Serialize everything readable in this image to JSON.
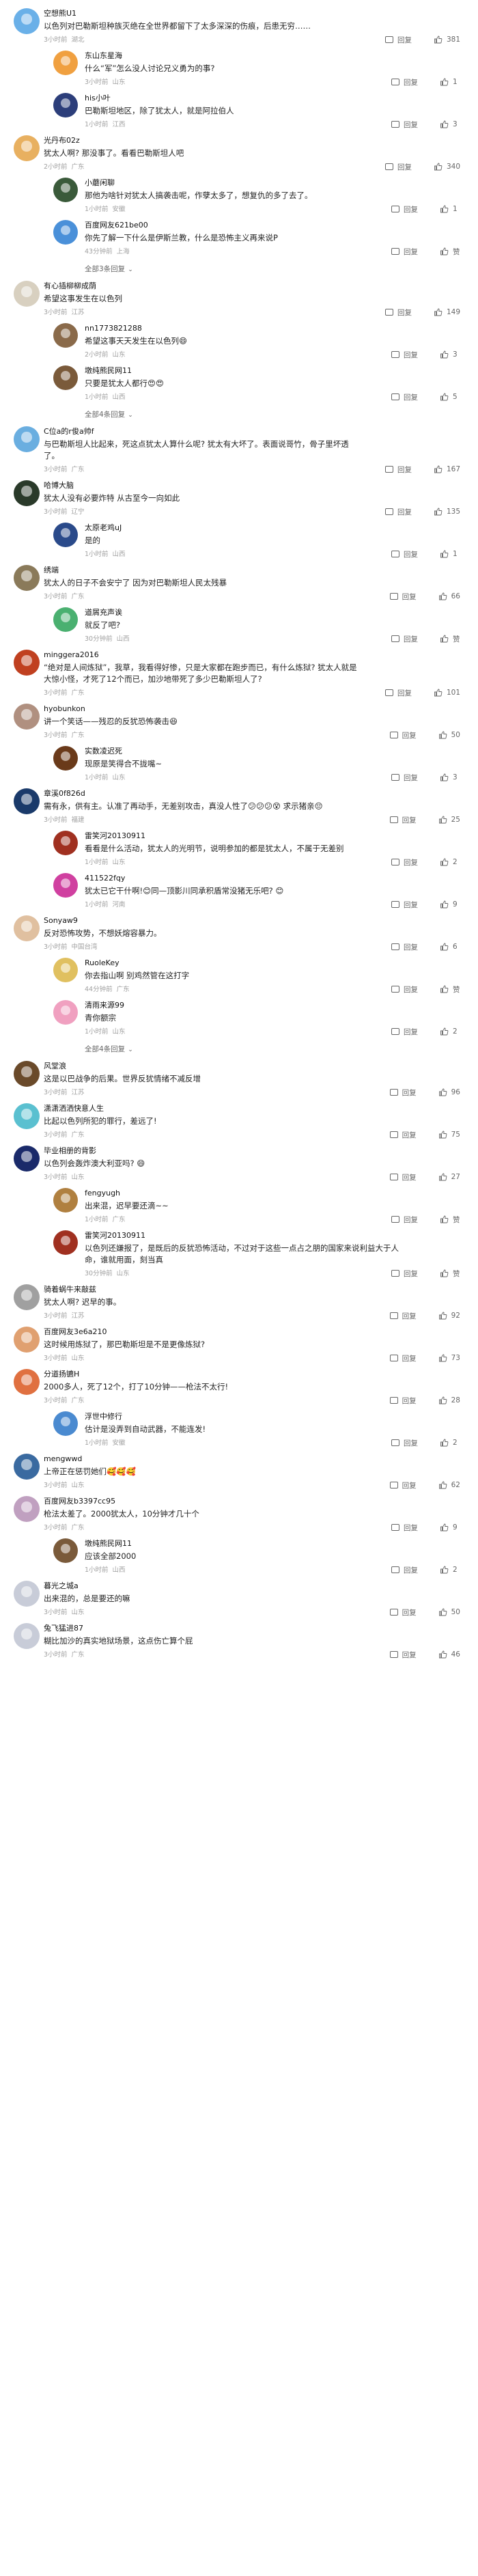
{
  "ui": {
    "reply_label": "回复",
    "zan_label": "赞",
    "more_suffix_icon": "chevron-down-icon"
  },
  "comments": [
    {
      "kind": "top",
      "user": "空想熊U1",
      "text": "以色列对巴勒斯坦种族灭绝在全世界都留下了太多深深的伤痕，后患无穷……",
      "time": "3小时前",
      "loc": "湖北",
      "likes": "381",
      "color": "#6ab0e8"
    },
    {
      "kind": "reply",
      "user": "东山东星海",
      "text": "什么“军”怎么没人讨论兄义勇为的事?",
      "time": "3小时前",
      "loc": "山东",
      "likes": "1",
      "color": "#f0a040"
    },
    {
      "kind": "reply",
      "user": "his小叶",
      "text": "巴勒斯坦地区，除了犹太人，就是阿拉伯人",
      "time": "1小时前",
      "loc": "江西",
      "likes": "3",
      "color": "#2c3e7a"
    },
    {
      "kind": "top",
      "user": "光丹布02z",
      "text": "犹太人啊? 那没事了。看看巴勒斯坦人吧",
      "time": "2小时前",
      "loc": "广东",
      "likes": "340",
      "color": "#e8b060"
    },
    {
      "kind": "reply",
      "user": "小蘑闲聊",
      "text": "那他为啥针对犹太人搞袭击呢，作孽太多了，想复仇的多了去了。",
      "time": "1小时前",
      "loc": "安徽",
      "likes": "1",
      "color": "#3a5a3a"
    },
    {
      "kind": "reply",
      "user": "百度网友621be00",
      "text": "你先了解一下什么是伊斯兰教，什么是恐怖主义再来说P",
      "time": "43分钟前",
      "loc": "上海",
      "likes": "",
      "color": "#4a90d9"
    },
    {
      "kind": "more",
      "text": "全部3条回复"
    },
    {
      "kind": "top",
      "user": "有心插柳柳成荫",
      "text": "希望这事发生在以色列",
      "time": "3小时前",
      "loc": "江苏",
      "likes": "149",
      "color": "#d8d0c0"
    },
    {
      "kind": "reply",
      "user": "nn1773821288",
      "text": "希望这事天天发生在以色列😄",
      "time": "2小时前",
      "loc": "山东",
      "likes": "3",
      "color": "#8a6a4a"
    },
    {
      "kind": "reply",
      "user": "墩纯熊民网11",
      "text": "只要是犹太人都行😍😍",
      "time": "1小时前",
      "loc": "山西",
      "likes": "5",
      "color": "#7a5a3a"
    },
    {
      "kind": "more",
      "text": "全部4条回复"
    },
    {
      "kind": "top",
      "user": "C位a的r俊a帅f",
      "text": "与巴勒斯坦人比起来，死这点犹太人算什么呢? 犹太有大坏了。表面说哥竹，骨子里坏透了。",
      "time": "3小时前",
      "loc": "广东",
      "likes": "167",
      "color": "#6aaee0"
    },
    {
      "kind": "top",
      "user": "哈博大脑",
      "text": "犹太人没有必要炸特 从古至今一向如此",
      "time": "3小时前",
      "loc": "辽宁",
      "likes": "135",
      "color": "#2a3a2a"
    },
    {
      "kind": "reply",
      "user": "太原老鸡uJ",
      "text": "是的",
      "time": "1小时前",
      "loc": "山西",
      "likes": "1",
      "color": "#2a4a8a"
    },
    {
      "kind": "top",
      "user": "绣端",
      "text": "犹太人的日子不会安宁了 因为对巴勒斯坦人民太残暴",
      "time": "3小时前",
      "loc": "广东",
      "likes": "66",
      "color": "#8a7a5a"
    },
    {
      "kind": "reply",
      "user": "道屑充声诶",
      "text": "就反了吧?",
      "time": "30分钟前",
      "loc": "山西",
      "likes": "",
      "color": "#4ab070"
    },
    {
      "kind": "top",
      "user": "minggera2016",
      "text": "“绝对是人间炼狱”，我草，我看得好惨，只是大家都在跑步而已，有什么炼狱? 犹太人就是大惊小怪，才死了12个而已，加沙地带死了多少巴勒斯坦人了?",
      "time": "3小时前",
      "loc": "广东",
      "likes": "101",
      "color": "#c04020"
    },
    {
      "kind": "top",
      "user": "hyobunkon",
      "text": "讲一个笑话——残忍的反犹恐怖袭击😆",
      "time": "3小时前",
      "loc": "广东",
      "likes": "50",
      "color": "#b09080"
    },
    {
      "kind": "reply",
      "user": "实数凌迟死",
      "text": "现原是笑得合不拢嘴~",
      "time": "1小时前",
      "loc": "山东",
      "likes": "3",
      "color": "#6a3a1a"
    },
    {
      "kind": "top",
      "user": "章溪0f826d",
      "text": "需有永，供有主。认准了再动手，无差别攻击，真没人性了😕😕😕😵 求示猪亲😔",
      "time": "3小时前",
      "loc": "福建",
      "likes": "25",
      "color": "#1a3a6a"
    },
    {
      "kind": "reply",
      "user": "雷笑河20130911",
      "text": "看看是什么活动，犹太人的光明节，说明参加的都是犹太人，不属于无差别",
      "time": "1小时前",
      "loc": "山东",
      "likes": "2",
      "color": "#a03020"
    },
    {
      "kind": "reply",
      "user": "411522fqy",
      "text": "犹太已它干什啊!😊同—顶影川同承积盾常没猪无乐吧? 😊",
      "time": "1小时前",
      "loc": "河南",
      "likes": "9",
      "color": "#d040a0"
    },
    {
      "kind": "top",
      "user": "Sonyaw9",
      "text": "反对恐怖攻势，不想妖熔容暴力。",
      "time": "3小时前",
      "loc": "中国台湾",
      "likes": "6",
      "color": "#e0c0a0"
    },
    {
      "kind": "reply",
      "user": "RuoleKey",
      "text": "你去指山啊 别鸡然管在这打字",
      "time": "44分钟前",
      "loc": "广东",
      "likes": "",
      "color": "#e0c060"
    },
    {
      "kind": "reply",
      "user": "清雨来源99",
      "text": "青你额宗",
      "time": "1小时前",
      "loc": "山东",
      "likes": "2",
      "color": "#f0a0c0"
    },
    {
      "kind": "more",
      "text": "全部4条回复"
    },
    {
      "kind": "top",
      "user": "风堂浪",
      "text": "这是以巴战争的后果。世界反犹情绪不减反增",
      "time": "3小时前",
      "loc": "江苏",
      "likes": "96",
      "color": "#6a4a2a"
    },
    {
      "kind": "top",
      "user": "潇潇洒洒快意人生",
      "text": "比起以色列所犯的罪行，差远了!",
      "time": "3小时前",
      "loc": "广东",
      "likes": "75",
      "color": "#5ac0d0"
    },
    {
      "kind": "top",
      "user": "毕业相册的背影",
      "text": "以色列会轰炸澳大利亚吗? 😄",
      "time": "3小时前",
      "loc": "山东",
      "likes": "27",
      "color": "#1a2a6a"
    },
    {
      "kind": "reply",
      "user": "fengyugh",
      "text": "出来混，迟早要还滴~~",
      "time": "1小时前",
      "loc": "广东",
      "likes": "",
      "color": "#b08040"
    },
    {
      "kind": "reply",
      "user": "雷笑河20130911",
      "text": "以色列还嫌报了，是既后的反犹恐怖活动，不过对于这些一点占之朋的国家来说利益大于人命，谁就用面，刻当真",
      "time": "30分钟前",
      "loc": "山东",
      "likes": "",
      "color": "#a03020"
    },
    {
      "kind": "top",
      "user": "骑着蜗牛来敲兹",
      "text": "犹太人啊? 迟早的事。",
      "time": "3小时前",
      "loc": "江苏",
      "likes": "92",
      "color": "#a0a0a0"
    },
    {
      "kind": "top",
      "user": "百度网友3e6a210",
      "text": "这时候用炼狱了，那巴勒斯坦是不是更像炼狱?",
      "time": "3小时前",
      "loc": "山东",
      "likes": "73",
      "color": "#e0a070"
    },
    {
      "kind": "top",
      "user": "分道扬镳H",
      "text": "2000多人，死了12个，打了10分钟——枪法不太行!",
      "time": "3小时前",
      "loc": "广东",
      "likes": "28",
      "color": "#e07040"
    },
    {
      "kind": "reply",
      "user": "浮世中修行",
      "text": "估计是没弄到自动武器，不能连发!",
      "time": "1小时前",
      "loc": "安徽",
      "likes": "2",
      "color": "#4a8ad0"
    },
    {
      "kind": "top",
      "user": "mengwwd",
      "text": "上帝正在惩罚她们🥰🥰🥰",
      "time": "3小时前",
      "loc": "山东",
      "likes": "62",
      "color": "#3a6aa0"
    },
    {
      "kind": "top",
      "user": "百度网友b3397cc95",
      "text": "枪法太差了。2000犹太人，10分钟才几十个",
      "time": "3小时前",
      "loc": "广东",
      "likes": "9",
      "color": "#c0a0c0"
    },
    {
      "kind": "reply",
      "user": "墩纯熊民网11",
      "text": "应该全部2000",
      "time": "1小时前",
      "loc": "山西",
      "likes": "2",
      "color": "#7a5a3a"
    },
    {
      "kind": "top",
      "user": "暮光之城a",
      "text": "出来混的，总是要还的嘛",
      "time": "3小时前",
      "loc": "山东",
      "likes": "50",
      "color": "#c8ccd8"
    },
    {
      "kind": "top",
      "user": "兔飞猛进87",
      "text": "糊比加沙的真实地狱场景，这点伤亡算个屁",
      "time": "3小时前",
      "loc": "广东",
      "likes": "46",
      "color": "#c8ccd8"
    }
  ]
}
